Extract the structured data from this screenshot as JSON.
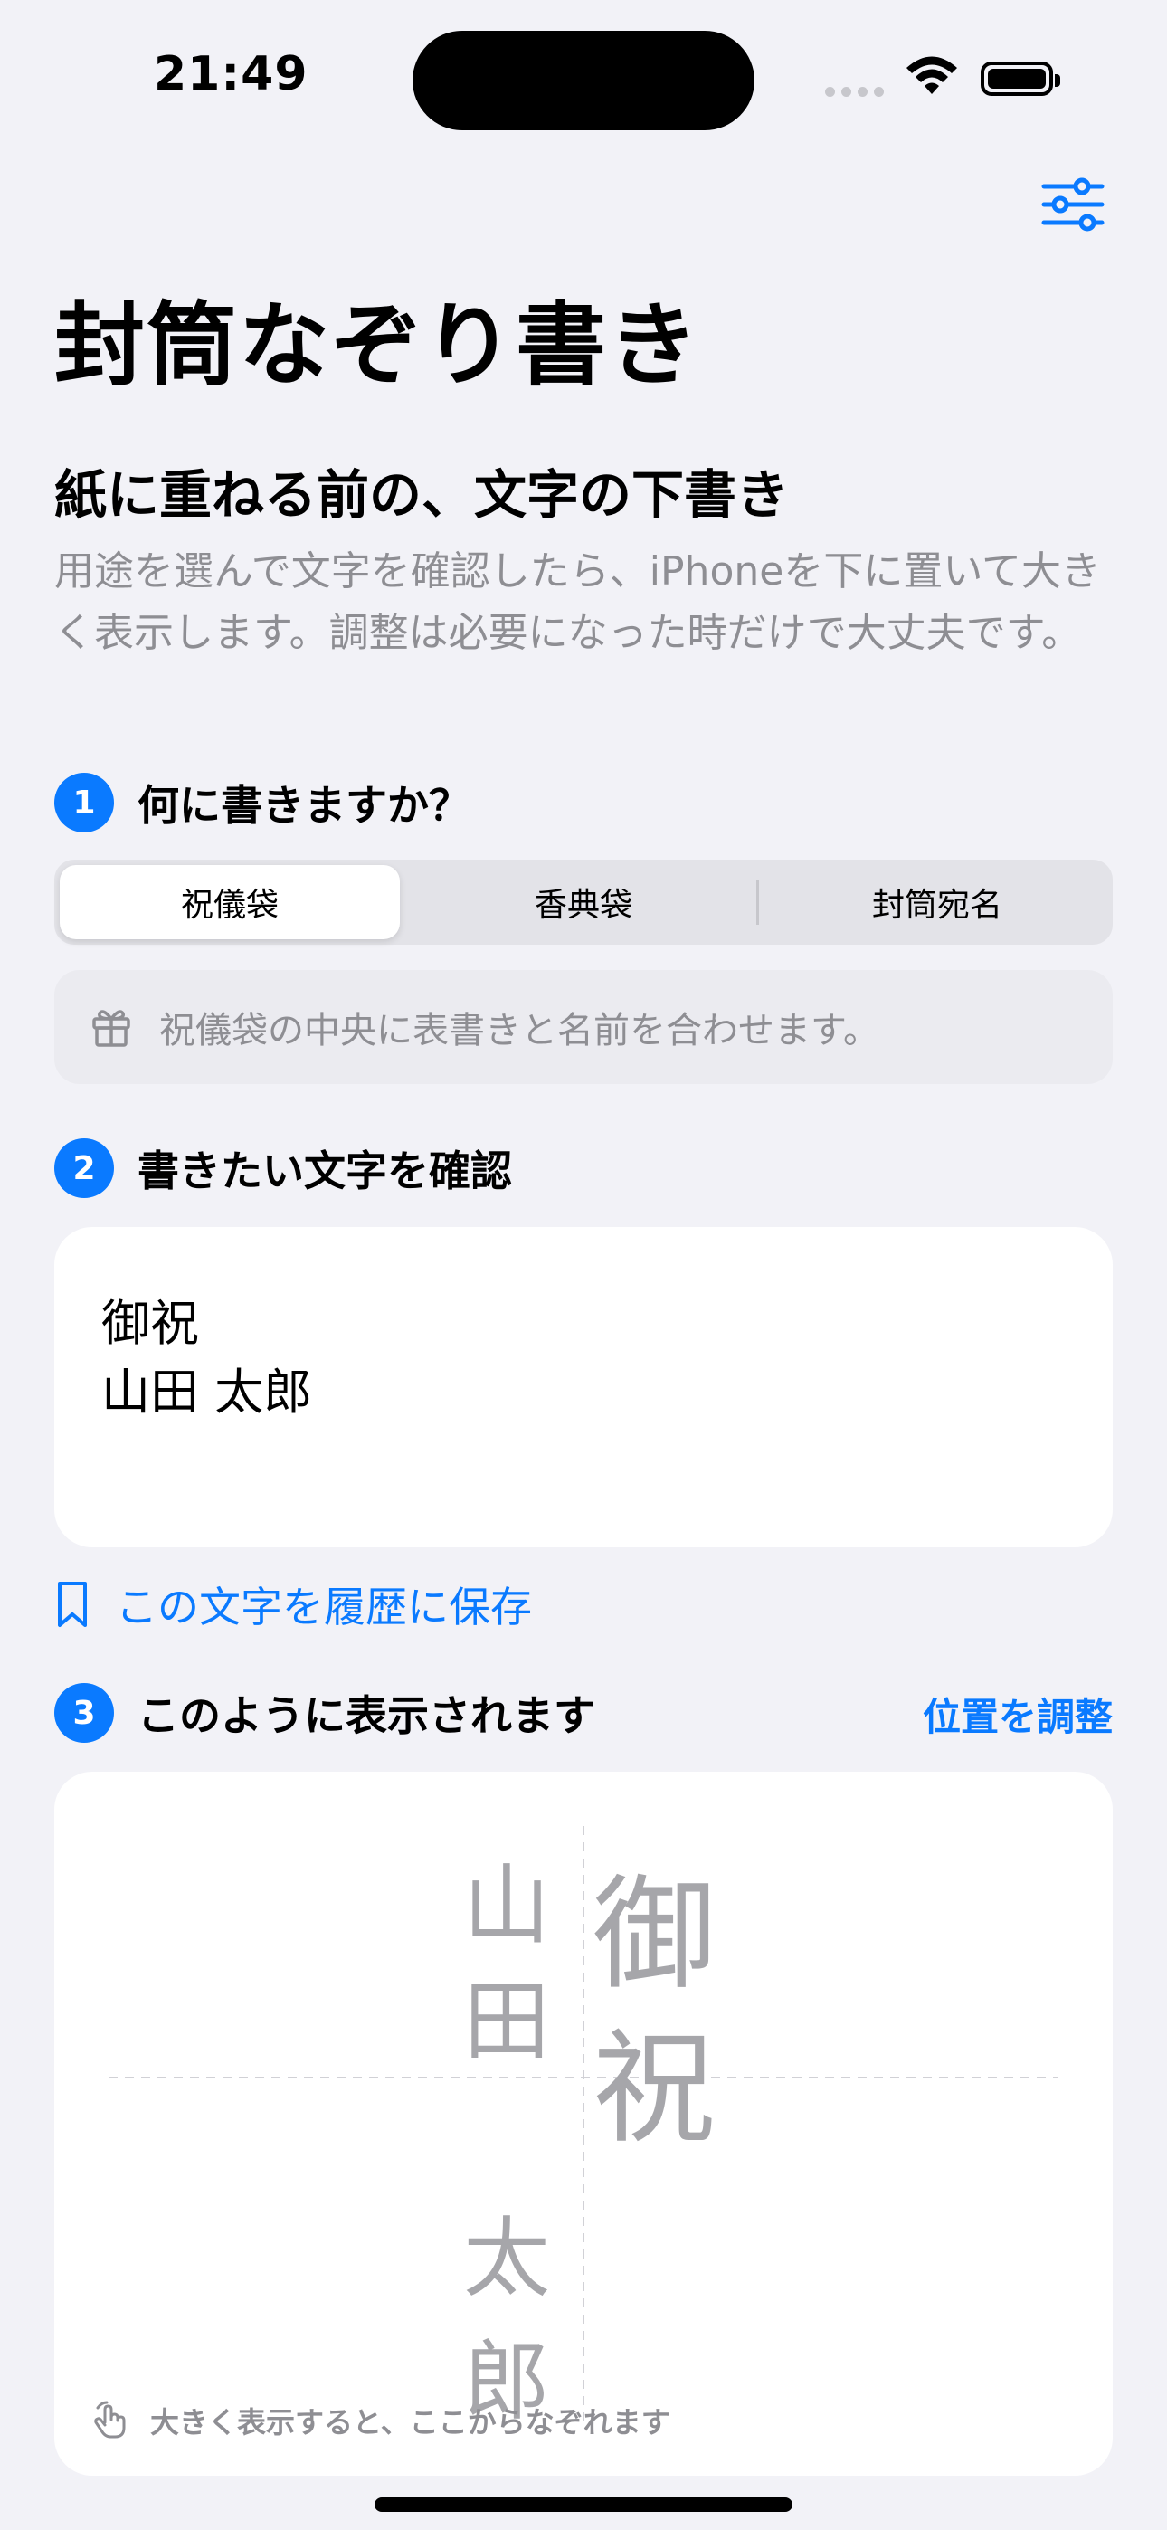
{
  "status_bar": {
    "time": "21:49"
  },
  "header": {
    "title": "封筒なぞり書き",
    "settings_icon": "sliders-icon"
  },
  "intro": {
    "subtitle": "紙に重ねる前の、文字の下書き",
    "lead": "用途を選んで文字を確認したら、iPhoneを下に置いて大きく表示します。調整は必要になった時だけで大丈夫です。"
  },
  "step1": {
    "number": "1",
    "label": "何に書きますか？",
    "segments": [
      "祝儀袋",
      "香典袋",
      "封筒宛名"
    ],
    "selected_index": 0,
    "hint_icon": "gift-icon",
    "hint": "祝儀袋の中央に表書きと名前を合わせます。"
  },
  "step2": {
    "number": "2",
    "label": "書きたい文字を確認",
    "text_line1": "御祝",
    "text_line2": "山田 太郎",
    "save_icon": "bookmark-icon",
    "save_label": "この文字を履歴に保存"
  },
  "step3": {
    "number": "3",
    "label": "このように表示されます",
    "adjust_label": "位置を調整",
    "preview": {
      "title_chars": [
        "御",
        "祝"
      ],
      "name_chars": [
        "山",
        "田",
        "太",
        "郎"
      ],
      "footer_icon": "hand-tap-icon",
      "footer": "大きく表示すると、ここからなぞれます"
    }
  },
  "colors": {
    "accent": "#0A7AFF",
    "background": "#F2F2F7",
    "secondary_text": "#8E8E93"
  }
}
